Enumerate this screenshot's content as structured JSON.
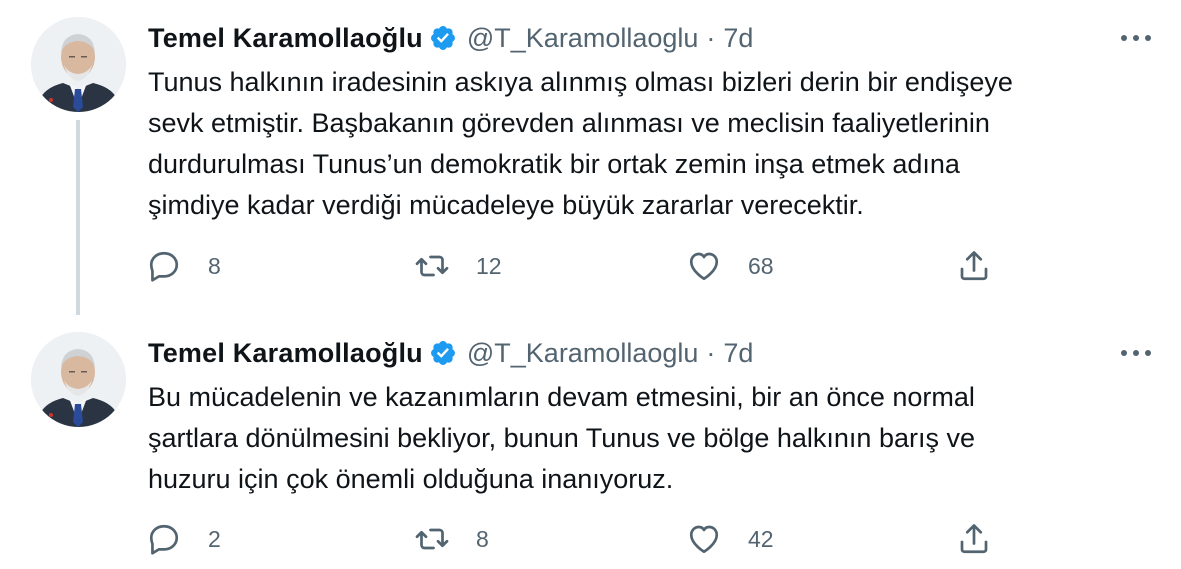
{
  "colors": {
    "text_primary": "#0f1419",
    "text_secondary": "#536471",
    "verified_blue": "#1d9bf0",
    "thread_line": "#cfd9de"
  },
  "icons": {
    "verified": "verified-badge-icon",
    "more": "more-options-icon",
    "reply": "reply-icon",
    "retweet": "retweet-icon",
    "like": "heart-icon",
    "share": "share-icon"
  },
  "tweets": [
    {
      "author": {
        "name": "Temel Karamollaoğlu",
        "handle": "@T_Karamollaoglu"
      },
      "separator": "·",
      "time": "7d",
      "text_lines": [
        "Tunus halkının iradesinin askıya alınmış olması bizleri derin bir endişeye",
        "sevk etmiştir. Başbakanın görevden alınması ve meclisin faaliyetlerinin",
        "durdurulması Tunus’un demokratik bir ortak zemin inşa etmek adına",
        "şimdiye kadar verdiği mücadeleye büyük zararlar verecektir."
      ],
      "stats": {
        "replies": "8",
        "retweets": "12",
        "likes": "68"
      }
    },
    {
      "author": {
        "name": "Temel Karamollaoğlu",
        "handle": "@T_Karamollaoglu"
      },
      "separator": "·",
      "time": "7d",
      "text_lines": [
        "Bu mücadelenin ve kazanımların devam etmesini, bir an önce normal",
        "şartlara dönülmesini bekliyor, bunun Tunus ve bölge halkının barış ve",
        "huzuru için çok önemli olduğuna inanıyoruz."
      ],
      "stats": {
        "replies": "2",
        "retweets": "8",
        "likes": "42"
      }
    }
  ]
}
